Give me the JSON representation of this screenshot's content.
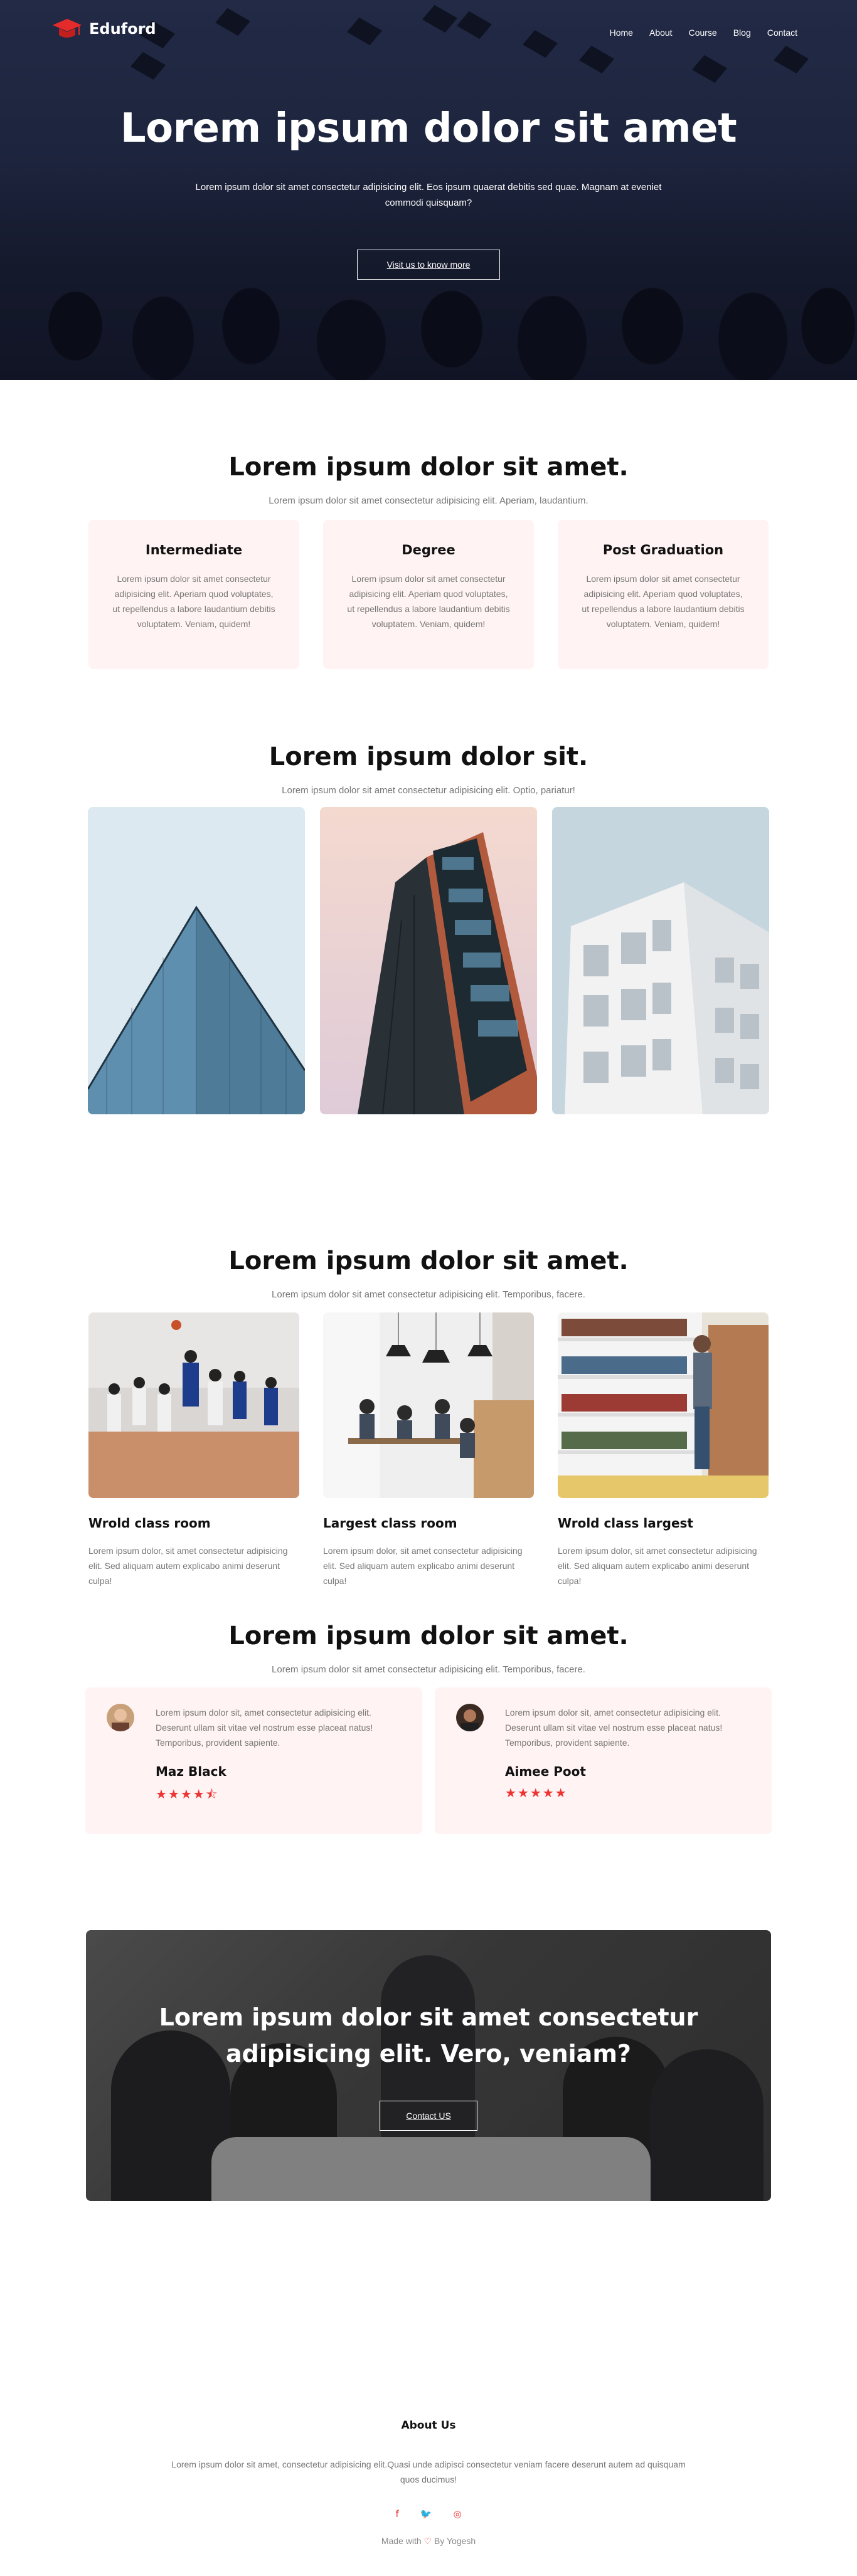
{
  "nav": {
    "brand": "Eduford",
    "links": [
      "Home",
      "About",
      "Course",
      "Blog",
      "Contact"
    ]
  },
  "hero": {
    "title": "Lorem ipsum dolor sit amet",
    "subtitle": "Lorem ipsum dolor sit amet consectetur adipisicing elit. Eos ipsum quaerat debitis sed quae. Magnam at eveniet commodi quisquam?",
    "button": "Visit us to know more"
  },
  "degrees": {
    "title": "Lorem ipsum dolor sit amet.",
    "subtitle": "Lorem ipsum dolor sit amet consectetur adipisicing elit. Aperiam, laudantium.",
    "cards": [
      {
        "title": "Intermediate",
        "text": "Lorem ipsum dolor sit amet consectetur adipisicing elit. Aperiam quod voluptates, ut repellendus a labore laudantium debitis voluptatem. Veniam, quidem!"
      },
      {
        "title": "Degree",
        "text": "Lorem ipsum dolor sit amet consectetur adipisicing elit. Aperiam quod voluptates, ut repellendus a labore laudantium debitis voluptatem. Veniam, quidem!"
      },
      {
        "title": "Post Graduation",
        "text": "Lorem ipsum dolor sit amet consectetur adipisicing elit. Aperiam quod voluptates, ut repellendus a labore laudantium debitis voluptatem. Veniam, quidem!"
      }
    ]
  },
  "campus": {
    "title": "Lorem ipsum dolor sit.",
    "subtitle": "Lorem ipsum dolor sit amet consectetur adipisicing elit. Optio, pariatur!"
  },
  "facilities": {
    "title": "Lorem ipsum dolor sit amet.",
    "subtitle": "Lorem ipsum dolor sit amet consectetur adipisicing elit. Temporibus, facere.",
    "items": [
      {
        "title": "Wrold class room",
        "text": "Lorem ipsum dolor, sit amet consectetur adipisicing elit. Sed aliquam autem explicabo animi deserunt culpa!"
      },
      {
        "title": "Largest class room",
        "text": "Lorem ipsum dolor, sit amet consectetur adipisicing elit. Sed aliquam autem explicabo animi deserunt culpa!"
      },
      {
        "title": "Wrold class largest",
        "text": "Lorem ipsum dolor, sit amet consectetur adipisicing elit. Sed aliquam autem explicabo animi deserunt culpa!"
      }
    ]
  },
  "testimonials": {
    "title": "Lorem ipsum dolor sit amet.",
    "subtitle": "Lorem ipsum dolor sit amet consectetur adipisicing elit. Temporibus, facere.",
    "items": [
      {
        "text": "Lorem ipsum dolor sit, amet consectetur adipisicing elit. Deserunt ullam sit vitae vel nostrum esse placeat natus! Temporibus, provident sapiente.",
        "name": "Maz Black",
        "rating": 4.5,
        "stars": "★★★★⯪"
      },
      {
        "text": "Lorem ipsum dolor sit, amet consectetur adipisicing elit. Deserunt ullam sit vitae vel nostrum esse placeat natus! Temporibus, provident sapiente.",
        "name": "Aimee Poot",
        "rating": 5,
        "stars": "★★★★★"
      }
    ]
  },
  "cta": {
    "title_line1": "Lorem ipsum dolor sit amet consectetur",
    "title_line2": "adipisicing elit. Vero, veniam?",
    "button": "Contact US"
  },
  "footer": {
    "title": "About Us",
    "text": "Lorem ipsum dolor sit amet, consectetur adipisicing elit.Quasi unde adipisci consectetur veniam facere deserunt autem ad quisquam quos ducimus!",
    "socials": [
      "f",
      "🐦",
      "◎"
    ],
    "made_prefix": "Made with",
    "heart": "♡",
    "made_suffix": "By Yogesh"
  },
  "colors": {
    "accent": "#e33b3b",
    "card_bg": "#fff3f3",
    "muted_text": "#777777"
  }
}
